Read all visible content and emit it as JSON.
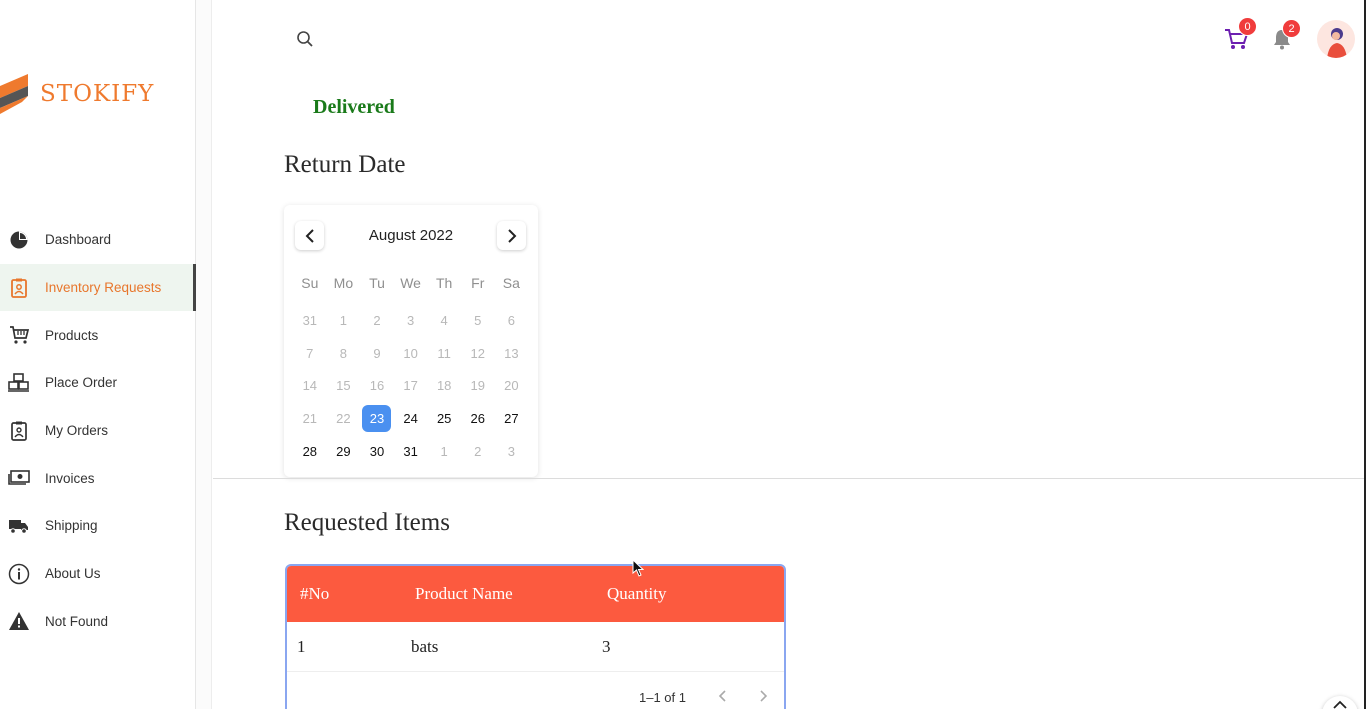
{
  "brand": {
    "name": "STOKIFY"
  },
  "sidebar": {
    "items": [
      {
        "label": "Dashboard",
        "icon": "pie-chart-icon"
      },
      {
        "label": "Inventory Requests",
        "icon": "clipboard-icon",
        "active": true
      },
      {
        "label": "Products",
        "icon": "cart-icon"
      },
      {
        "label": "Place Order",
        "icon": "boxes-icon"
      },
      {
        "label": "My Orders",
        "icon": "badge-icon"
      },
      {
        "label": "Invoices",
        "icon": "money-icon"
      },
      {
        "label": "Shipping",
        "icon": "truck-icon"
      },
      {
        "label": "About Us",
        "icon": "info-icon"
      },
      {
        "label": "Not Found",
        "icon": "warning-icon"
      }
    ]
  },
  "header": {
    "cart_count": "0",
    "notification_count": "2"
  },
  "request": {
    "status": "Delivered",
    "return_date_title": "Return Date"
  },
  "calendar": {
    "month_label": "August 2022",
    "weekdays": [
      "Su",
      "Mo",
      "Tu",
      "We",
      "Th",
      "Fr",
      "Sa"
    ],
    "days": [
      {
        "d": "31",
        "cur": false
      },
      {
        "d": "1",
        "cur": false
      },
      {
        "d": "2",
        "cur": false
      },
      {
        "d": "3",
        "cur": false
      },
      {
        "d": "4",
        "cur": false
      },
      {
        "d": "5",
        "cur": false
      },
      {
        "d": "6",
        "cur": false
      },
      {
        "d": "7",
        "cur": false
      },
      {
        "d": "8",
        "cur": false
      },
      {
        "d": "9",
        "cur": false
      },
      {
        "d": "10",
        "cur": false
      },
      {
        "d": "11",
        "cur": false
      },
      {
        "d": "12",
        "cur": false
      },
      {
        "d": "13",
        "cur": false
      },
      {
        "d": "14",
        "cur": false
      },
      {
        "d": "15",
        "cur": false
      },
      {
        "d": "16",
        "cur": false
      },
      {
        "d": "17",
        "cur": false
      },
      {
        "d": "18",
        "cur": false
      },
      {
        "d": "19",
        "cur": false
      },
      {
        "d": "20",
        "cur": false
      },
      {
        "d": "21",
        "cur": false
      },
      {
        "d": "22",
        "cur": false
      },
      {
        "d": "23",
        "cur": true,
        "selected": true
      },
      {
        "d": "24",
        "cur": true
      },
      {
        "d": "25",
        "cur": true
      },
      {
        "d": "26",
        "cur": true
      },
      {
        "d": "27",
        "cur": true
      },
      {
        "d": "28",
        "cur": true
      },
      {
        "d": "29",
        "cur": true
      },
      {
        "d": "30",
        "cur": true
      },
      {
        "d": "31",
        "cur": true
      },
      {
        "d": "1",
        "cur": false
      },
      {
        "d": "2",
        "cur": false
      },
      {
        "d": "3",
        "cur": false
      }
    ]
  },
  "items": {
    "title": "Requested Items",
    "columns": [
      "#No",
      "Product Name",
      "Quantity"
    ],
    "rows": [
      [
        "1",
        "bats",
        "3"
      ]
    ],
    "pagination": "1–1 of 1"
  },
  "colors": {
    "brand": "#ef7a2e",
    "status": "#1a7a1a",
    "table_header": "#fc5a3f",
    "selected_day": "#4a90f0",
    "badge": "#f03c3c"
  }
}
